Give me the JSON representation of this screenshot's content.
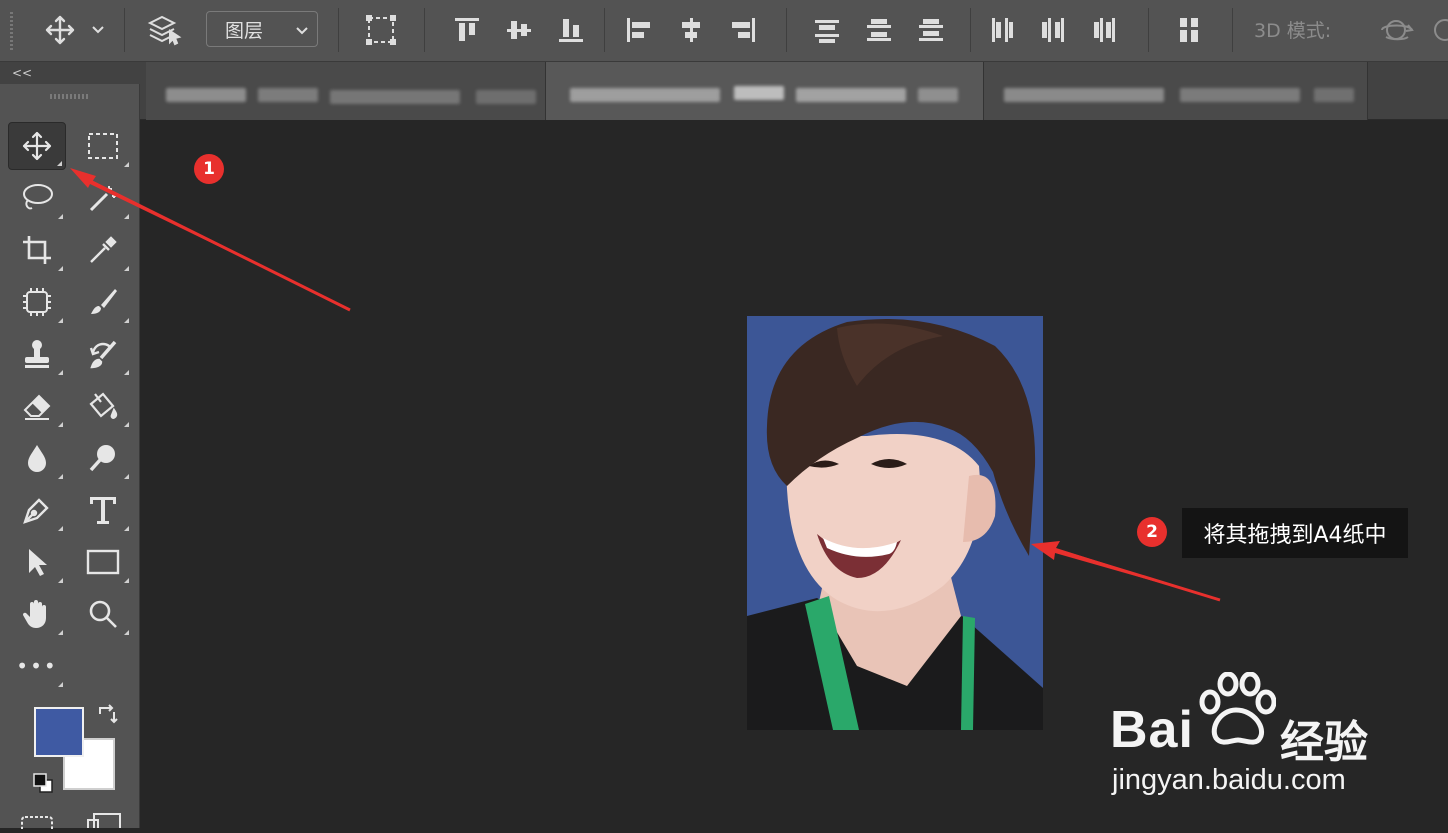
{
  "options_bar": {
    "layer_select_value": "图层",
    "mode_label": "3D 模式:"
  },
  "tabs": [
    {
      "label": "",
      "active": false
    },
    {
      "label": "",
      "active": true
    },
    {
      "label": "",
      "active": false
    }
  ],
  "toolbox": {
    "collapse_label": "<<",
    "more_tools_label": "•••",
    "foreground_color": "#3f5aa3",
    "background_color": "#ffffff"
  },
  "annotations": {
    "step1_badge": "1",
    "step2_badge": "2",
    "step2_text": "将其拖拽到A4纸中",
    "arrow_color": "#e8302d"
  },
  "watermark": {
    "brand": "Bai",
    "brand_cn": "经验",
    "url": "jingyan.baidu.com"
  }
}
